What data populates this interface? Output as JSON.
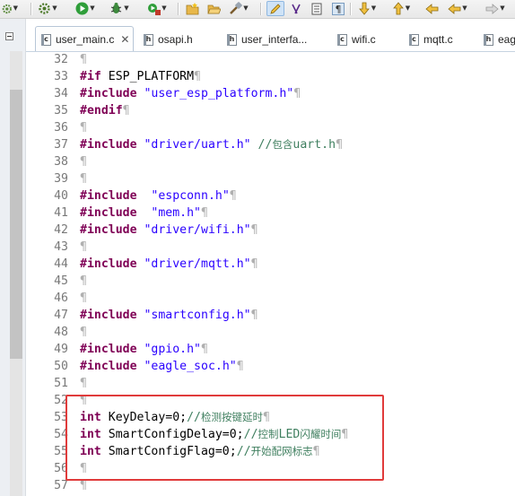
{
  "tabs": [
    {
      "name": "user_main.c",
      "type": "c",
      "active": true,
      "closable": true
    },
    {
      "name": "osapi.h",
      "type": "h"
    },
    {
      "name": "user_interfa...",
      "type": "h"
    },
    {
      "name": "wifi.c",
      "type": "c"
    },
    {
      "name": "mqtt.c",
      "type": "c"
    },
    {
      "name": "eag",
      "type": "h"
    }
  ],
  "tab_close_glyph": "✕",
  "toolbar_icons": [
    "gear-icon",
    "run-icon",
    "debug-icon",
    "external-tools-icon",
    "new-folder-icon",
    "open-folder-icon",
    "build-icon",
    "pen-icon",
    "format-icon",
    "pages-icon",
    "paragraph-icon",
    "next-annotation-icon",
    "prev-annotation-icon",
    "back-icon",
    "forward-icon"
  ],
  "editor": {
    "pilcrow": "¶",
    "lines": [
      {
        "n": "32",
        "parts": []
      },
      {
        "n": "33",
        "parts": [
          {
            "t": "#if",
            "c": "kw"
          },
          {
            "t": " ESP_PLATFORM",
            "c": "plain"
          }
        ]
      },
      {
        "n": "34",
        "parts": [
          {
            "t": "#include",
            "c": "kw"
          },
          {
            "t": " ",
            "c": "plain"
          },
          {
            "t": "\"user_esp_platform.h\"",
            "c": "str"
          }
        ]
      },
      {
        "n": "35",
        "parts": [
          {
            "t": "#endif",
            "c": "kw"
          }
        ]
      },
      {
        "n": "36",
        "parts": []
      },
      {
        "n": "37",
        "parts": [
          {
            "t": "#include",
            "c": "kw"
          },
          {
            "t": " ",
            "c": "plain"
          },
          {
            "t": "\"driver/uart.h\"",
            "c": "str"
          },
          {
            "t": " ",
            "c": "plain"
          },
          {
            "t": "//包含uart.h",
            "c": "cmt"
          }
        ]
      },
      {
        "n": "38",
        "parts": []
      },
      {
        "n": "39",
        "parts": []
      },
      {
        "n": "40",
        "parts": [
          {
            "t": "#include",
            "c": "kw"
          },
          {
            "t": "  ",
            "c": "plain"
          },
          {
            "t": "\"espconn.h\"",
            "c": "str"
          }
        ]
      },
      {
        "n": "41",
        "parts": [
          {
            "t": "#include",
            "c": "kw"
          },
          {
            "t": "  ",
            "c": "plain"
          },
          {
            "t": "\"mem.h\"",
            "c": "str"
          }
        ]
      },
      {
        "n": "42",
        "parts": [
          {
            "t": "#include",
            "c": "kw"
          },
          {
            "t": " ",
            "c": "plain"
          },
          {
            "t": "\"driver/wifi.h\"",
            "c": "str"
          }
        ]
      },
      {
        "n": "43",
        "parts": []
      },
      {
        "n": "44",
        "parts": [
          {
            "t": "#include",
            "c": "kw"
          },
          {
            "t": " ",
            "c": "plain"
          },
          {
            "t": "\"driver/mqtt.h\"",
            "c": "str"
          }
        ]
      },
      {
        "n": "45",
        "parts": []
      },
      {
        "n": "46",
        "parts": []
      },
      {
        "n": "47",
        "parts": [
          {
            "t": "#include",
            "c": "kw"
          },
          {
            "t": " ",
            "c": "plain"
          },
          {
            "t": "\"smartconfig.h\"",
            "c": "str"
          }
        ]
      },
      {
        "n": "48",
        "parts": []
      },
      {
        "n": "49",
        "parts": [
          {
            "t": "#include",
            "c": "kw"
          },
          {
            "t": " ",
            "c": "plain"
          },
          {
            "t": "\"gpio.h\"",
            "c": "str"
          }
        ]
      },
      {
        "n": "50",
        "parts": [
          {
            "t": "#include",
            "c": "kw"
          },
          {
            "t": " ",
            "c": "plain"
          },
          {
            "t": "\"eagle_soc.h\"",
            "c": "str"
          }
        ]
      },
      {
        "n": "51",
        "parts": []
      },
      {
        "n": "52",
        "parts": []
      },
      {
        "n": "53",
        "parts": [
          {
            "t": "int",
            "c": "kw"
          },
          {
            "t": " KeyDelay=0;",
            "c": "plain"
          },
          {
            "t": "//检测按键延时",
            "c": "cmt"
          }
        ]
      },
      {
        "n": "54",
        "parts": [
          {
            "t": "int",
            "c": "kw"
          },
          {
            "t": " SmartConfigDelay=0;",
            "c": "plain"
          },
          {
            "t": "//控制LED闪耀时间",
            "c": "cmt"
          }
        ]
      },
      {
        "n": "55",
        "parts": [
          {
            "t": "int",
            "c": "kw"
          },
          {
            "t": " SmartConfigFlag=0;",
            "c": "plain"
          },
          {
            "t": "//开始配网标志",
            "c": "cmt"
          }
        ]
      },
      {
        "n": "56",
        "parts": []
      },
      {
        "n": "57",
        "parts": []
      }
    ]
  },
  "colors": {
    "keyword": "#7f0055",
    "string": "#2a00ff",
    "comment": "#3f7f5f",
    "highlight_box": "#e03b3b"
  }
}
